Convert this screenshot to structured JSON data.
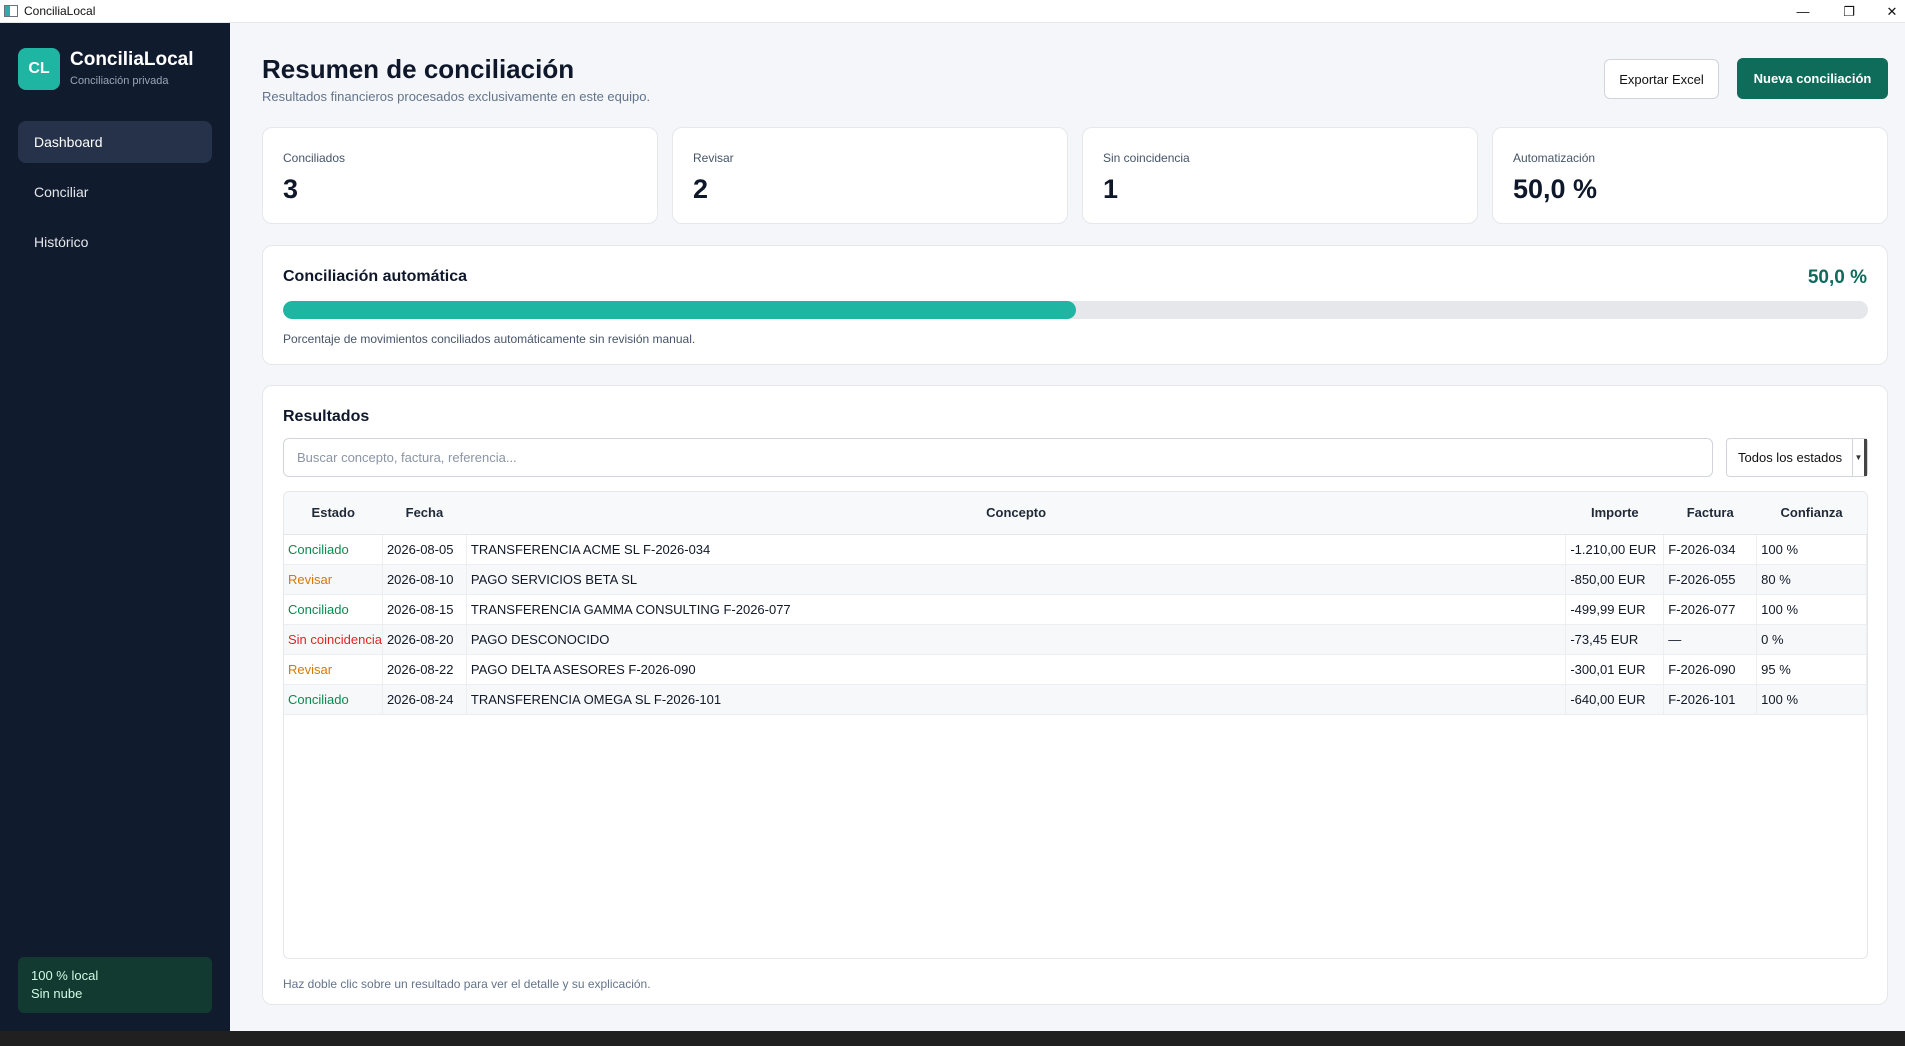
{
  "window": {
    "title": "ConciliaLocal"
  },
  "sidebar": {
    "logo_text": "CL",
    "brand": "ConciliaLocal",
    "brand_sub": "Conciliación privada",
    "items": [
      {
        "label": "Dashboard",
        "active": true
      },
      {
        "label": "Conciliar",
        "active": false
      },
      {
        "label": "Histórico",
        "active": false
      }
    ],
    "local_line1": "100 % local",
    "local_line2": "Sin nube"
  },
  "header": {
    "title": "Resumen de conciliación",
    "subtitle": "Resultados financieros procesados exclusivamente en este equipo.",
    "export_label": "Exportar Excel",
    "new_label": "Nueva conciliación"
  },
  "stats": [
    {
      "label": "Conciliados",
      "value": "3"
    },
    {
      "label": "Revisar",
      "value": "2"
    },
    {
      "label": "Sin coincidencia",
      "value": "1"
    },
    {
      "label": "Automatización",
      "value": "50,0 %"
    }
  ],
  "automatic": {
    "title": "Conciliación automática",
    "percent_label": "50,0 %",
    "progress": 0.5,
    "description": "Porcentaje de movimientos conciliados automáticamente sin revisión manual."
  },
  "results": {
    "title": "Resultados",
    "search_placeholder": "Buscar concepto, factura, referencia...",
    "filter_selected": "Todos los estados",
    "columns": [
      "Estado",
      "Fecha",
      "Concepto",
      "Importe",
      "Factura",
      "Confianza"
    ],
    "rows": [
      {
        "status": "Conciliado",
        "status_kind": "ok",
        "date": "2026-08-05",
        "concept": "TRANSFERENCIA ACME SL F-2026-034",
        "amount": "-1.210,00 EUR",
        "invoice": "F-2026-034",
        "confidence": "100 %"
      },
      {
        "status": "Revisar",
        "status_kind": "rev",
        "date": "2026-08-10",
        "concept": "PAGO SERVICIOS BETA SL",
        "amount": "-850,00 EUR",
        "invoice": "F-2026-055",
        "confidence": "80 %"
      },
      {
        "status": "Conciliado",
        "status_kind": "ok",
        "date": "2026-08-15",
        "concept": "TRANSFERENCIA GAMMA CONSULTING F-2026-077",
        "amount": "-499,99 EUR",
        "invoice": "F-2026-077",
        "confidence": "100 %"
      },
      {
        "status": "Sin coincidencia",
        "status_kind": "no",
        "date": "2026-08-20",
        "concept": "PAGO DESCONOCIDO",
        "amount": "-73,45 EUR",
        "invoice": "—",
        "confidence": "0 %"
      },
      {
        "status": "Revisar",
        "status_kind": "rev",
        "date": "2026-08-22",
        "concept": "PAGO DELTA ASESORES F-2026-090",
        "amount": "-300,01 EUR",
        "invoice": "F-2026-090",
        "confidence": "95 %"
      },
      {
        "status": "Conciliado",
        "status_kind": "ok",
        "date": "2026-08-24",
        "concept": "TRANSFERENCIA OMEGA SL F-2026-101",
        "amount": "-640,00 EUR",
        "invoice": "F-2026-101",
        "confidence": "100 %"
      }
    ],
    "hint": "Haz doble clic sobre un resultado para ver el detalle y su explicación."
  },
  "colors": {
    "accent": "#1fb5a3",
    "primary": "#0f6b5a",
    "sidebar": "#111b2e",
    "ok": "#0a8a4f",
    "review": "#d97706",
    "nomatch": "#dc2626"
  }
}
